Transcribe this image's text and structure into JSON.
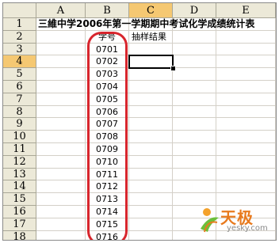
{
  "sheet": {
    "columns": [
      "A",
      "B",
      "C",
      "D",
      "E"
    ],
    "rows": [
      "1",
      "2",
      "3",
      "4",
      "5",
      "6",
      "7",
      "8",
      "9",
      "10",
      "11",
      "12",
      "13",
      "14",
      "15",
      "16",
      "17",
      "18"
    ],
    "active_column": "C",
    "active_row": "4",
    "title": "三維中学2006年第一学期期中考试化学成绩统计表",
    "header_b": "学号",
    "header_c": "抽样结果",
    "student_ids": [
      "0701",
      "0702",
      "0703",
      "0704",
      "0705",
      "0706",
      "0707",
      "0708",
      "0709",
      "0710",
      "0711",
      "0712",
      "0713",
      "0714",
      "0715",
      "0716"
    ]
  },
  "highlight_color": "#d8262d",
  "watermark": {
    "brand": "天极",
    "url": "yesky.com"
  }
}
